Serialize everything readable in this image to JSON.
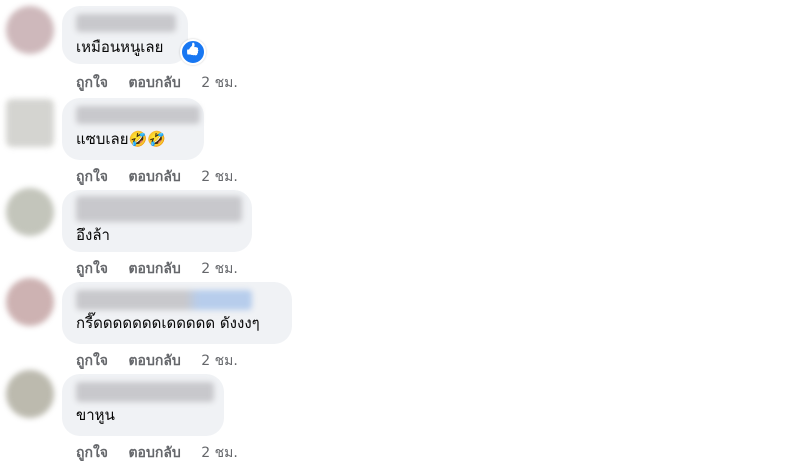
{
  "comments": [
    {
      "text": "เหมือนหนูเลย",
      "reaction_icon": "like-icon",
      "actions": {
        "like": "ถูกใจ",
        "reply": "ตอบกลับ",
        "time": "2 ชม."
      }
    },
    {
      "text": "แซบเลย🤣🤣",
      "actions": {
        "like": "ถูกใจ",
        "reply": "ตอบกลับ",
        "time": "2 ชม."
      }
    },
    {
      "text": "อึงล้า",
      "actions": {
        "like": "ถูกใจ",
        "reply": "ตอบกลับ",
        "time": "2 ชม."
      }
    },
    {
      "text": "กรี๊ดดดดดดดเดดดดด ดังงงๆ",
      "actions": {
        "like": "ถูกใจ",
        "reply": "ตอบกลับ",
        "time": "2 ชม."
      }
    },
    {
      "text": "ขาหูน",
      "actions": {
        "like": "ถูกใจ",
        "reply": "ตอบกลับ",
        "time": "2 ชม."
      }
    }
  ],
  "colors": {
    "bubble": "#f0f2f5",
    "action_text": "#65676b",
    "like_blue": "#1877f2"
  }
}
